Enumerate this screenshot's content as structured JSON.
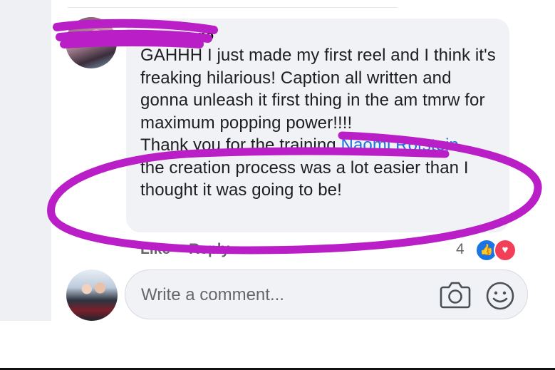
{
  "comment": {
    "author_partial": "ono",
    "paragraphs": [
      "GAHHH I just made my first reel and I think it's freaking hilarious! Caption all written and gonna unleash it first thing in the am tmrw for maximum popping power!!!!",
      ""
    ],
    "second_before": "Thank you for the training ",
    "mention": "Naomi Rotstein",
    "second_after": ".... the creation process was a lot easier than I thought it was going to be!"
  },
  "actions": {
    "like": "Like",
    "reply": "Reply"
  },
  "reactions": {
    "count": "4",
    "like_icon": "thumbs-up",
    "love_icon": "heart"
  },
  "composer": {
    "placeholder": "Write a comment...",
    "camera_icon": "camera",
    "emoji_icon": "smiley-face"
  },
  "colors": {
    "mention": "#216fdb",
    "bubble": "#f0f2f5",
    "annotation": "#b91ec7",
    "like": "#1b74e4",
    "love": "#f33e58"
  }
}
